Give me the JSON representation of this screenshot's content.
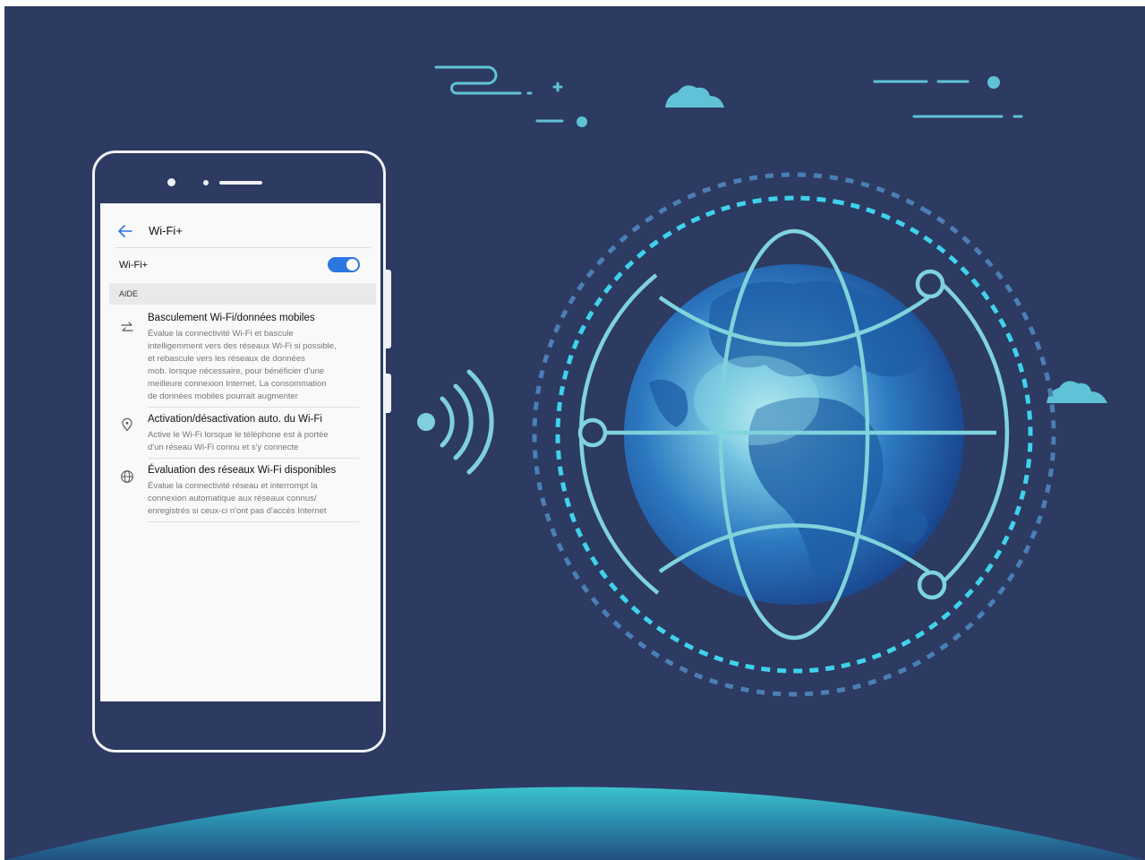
{
  "colors": {
    "background": "#2d3a61",
    "accent": "#63c7d6",
    "toggle_on": "#2c76e0"
  },
  "screen": {
    "header": {
      "title": "Wi-Fi+",
      "back_icon": "arrow-left-icon"
    },
    "wifi_toggle": {
      "label": "Wi-Fi+",
      "state": "on"
    },
    "section": {
      "label": "AIDE"
    },
    "items": [
      {
        "icon": "swap-arrows-icon",
        "title": "Basculement Wi-Fi/données mobiles",
        "lines": [
          "Évalue la connectivité Wi-Fi et bascule",
          "intelligemment vers des réseaux Wi-Fi si possible,",
          "et rebascule vers les réseaux de données",
          "mob. lorsque nécessaire, pour bénéficier d'une",
          "meilleure connexion Internet. La consommation",
          "de données mobiles pourrait augmenter"
        ]
      },
      {
        "icon": "location-pin-icon",
        "title": "Activation/désactivation auto. du Wi-Fi",
        "lines": [
          "Active le Wi-Fi lorsque le téléphone est à portée",
          "d'un réseau Wi-Fi connu et s'y connecte"
        ]
      },
      {
        "icon": "globe-icon",
        "title": "Évaluation des réseaux Wi-Fi disponibles",
        "lines": [
          "Évalue la connectivité réseau et interrompt la",
          "connexion automatique aux réseaux connus/",
          "enregistrés si ceux-ci n'ont pas d'accès Internet"
        ]
      }
    ]
  },
  "illustration": {
    "icons": [
      "wifi-signal-icon",
      "globe-icon",
      "cloud-icon",
      "wind-icon"
    ]
  }
}
